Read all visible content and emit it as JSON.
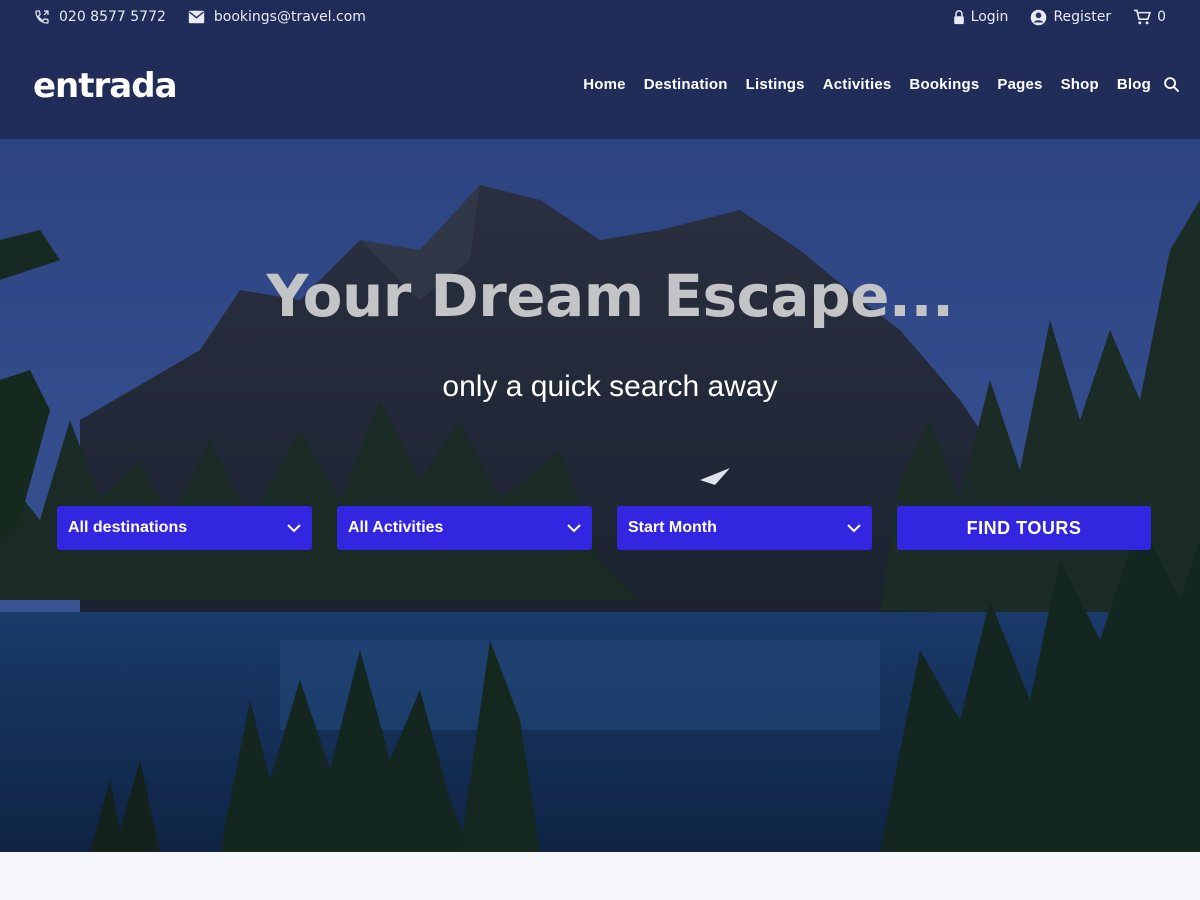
{
  "topbar": {
    "phone": "020 8577 5772",
    "email": "bookings@travel.com",
    "login": "Login",
    "register": "Register",
    "cart_count": "0"
  },
  "brand": {
    "logo": "entrada"
  },
  "nav": {
    "items": [
      "Home",
      "Destination",
      "Listings",
      "Activities",
      "Bookings",
      "Pages",
      "Shop",
      "Blog"
    ]
  },
  "hero": {
    "headline": "Your Dream Escape...",
    "subheadline": "only a quick search away"
  },
  "search": {
    "destination": "All destinations",
    "activity": "All Activities",
    "month": "Start Month",
    "button": "FIND TOURS"
  },
  "colors": {
    "accent": "#3326e0",
    "navbar": "#1e2850"
  },
  "icons": [
    "phone-icon",
    "mail-icon",
    "lock-icon",
    "user-icon",
    "cart-icon",
    "search-icon",
    "chevron-down-icon"
  ]
}
